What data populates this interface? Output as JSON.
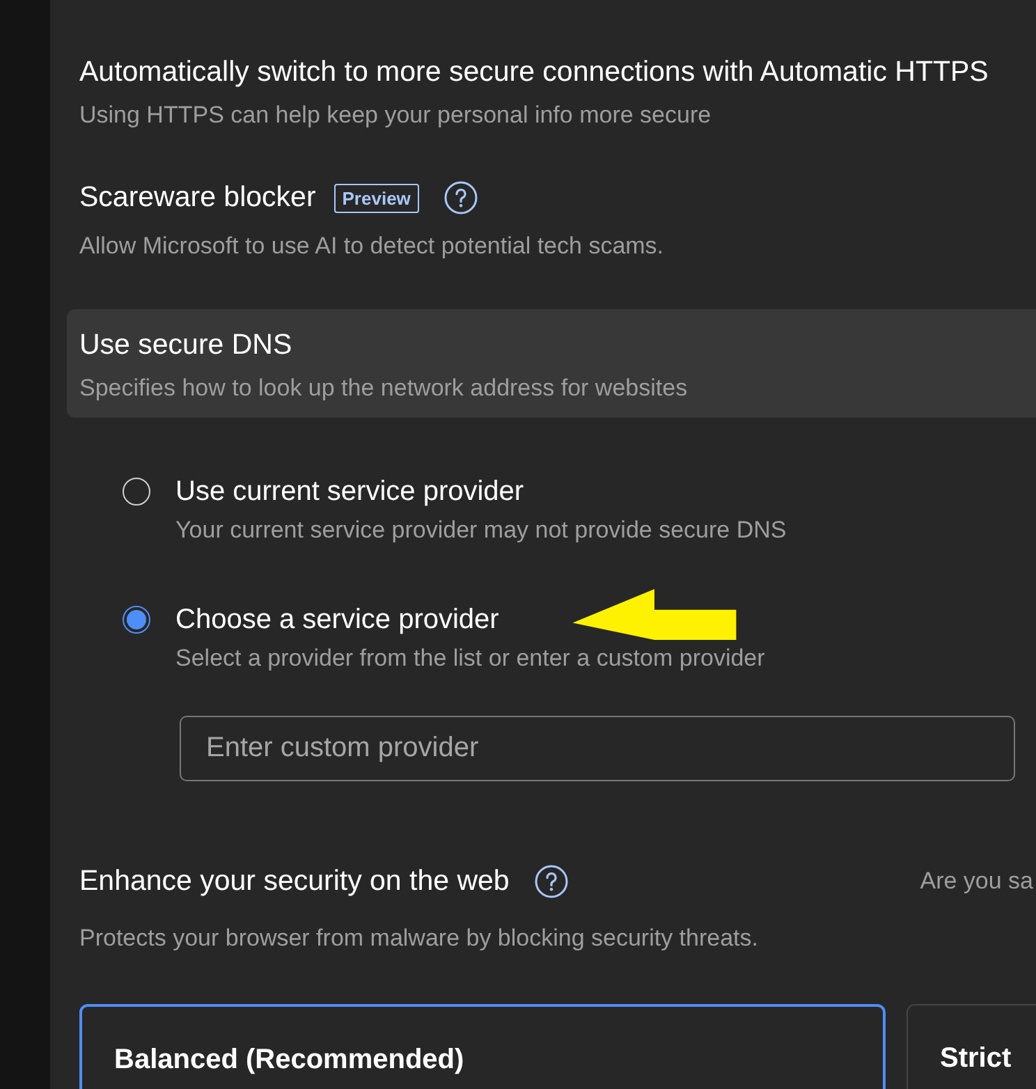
{
  "settings": [
    {
      "title": "Automatically switch to more secure connections with Automatic HTTPS",
      "description": "Using HTTPS can help keep your personal info more secure",
      "highlighted": false
    },
    {
      "title": "Scareware blocker",
      "badge": "Preview",
      "help": true,
      "description": "Allow Microsoft to use AI to detect potential tech scams.",
      "highlighted": false
    },
    {
      "title": "Use secure DNS",
      "description": "Specifies how to look up the network address for websites",
      "highlighted": true
    }
  ],
  "dns_options": [
    {
      "label": "Use current service provider",
      "description": "Your current service provider may not provide secure DNS",
      "selected": false
    },
    {
      "label": "Choose a service provider",
      "description": "Select a provider from the list or enter a custom provider",
      "selected": true
    }
  ],
  "custom_provider": {
    "placeholder": "Enter custom provider"
  },
  "security": {
    "title": "Enhance your security on the web",
    "help": true,
    "side_text": "Are you sa",
    "description": "Protects your browser from malware by blocking security threats."
  },
  "modes": [
    {
      "label": "Balanced (Recommended)",
      "selected": true
    },
    {
      "label": "Strict",
      "selected": false
    }
  ]
}
